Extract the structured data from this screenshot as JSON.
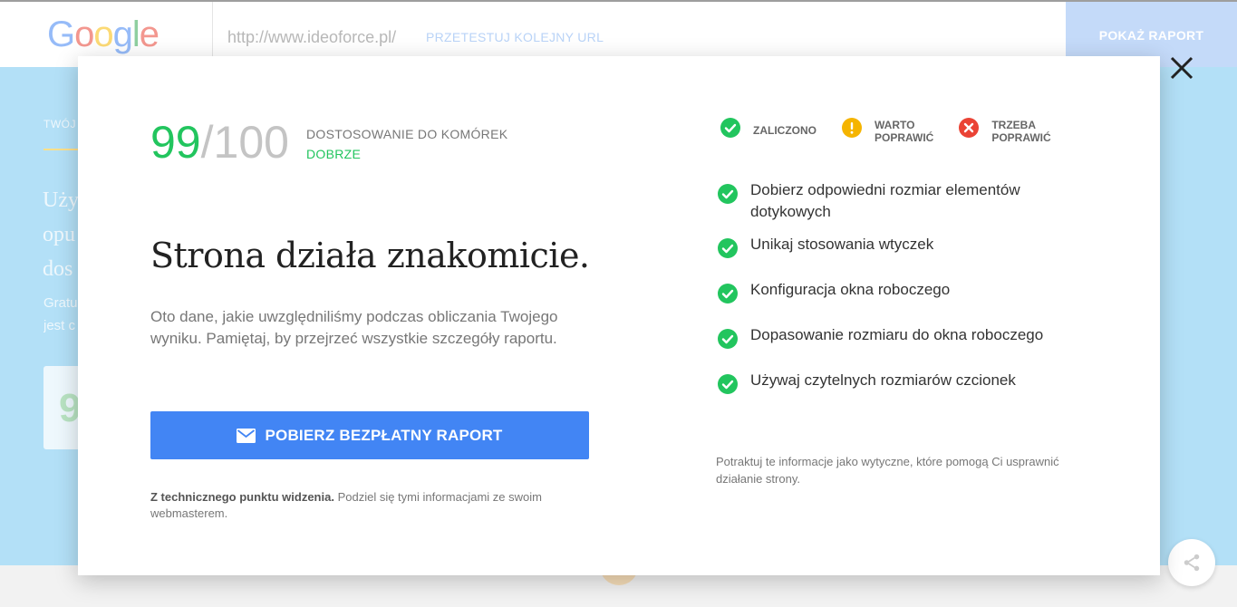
{
  "background": {
    "logo": {
      "g1": "G",
      "o1": "o",
      "o2": "o",
      "g2": "g",
      "l": "l",
      "e": "e"
    },
    "url": "http://www.ideoforce.pl/",
    "retest_label": "PRZETESTUJ KOLEJNY URL",
    "show_report_label": "POKAŻ RAPORT",
    "hero_label": "TWÓJ",
    "hero_text": [
      "Uży",
      "opu",
      "dos"
    ],
    "hero_small": [
      "Gratu",
      "jest c"
    ],
    "hero_card_value": "9"
  },
  "modal": {
    "close_icon": "close-icon",
    "score": {
      "value": "99",
      "max": "/100"
    },
    "score_title": "DOSTOSOWANIE DO KOMÓREK",
    "score_status": "DOBRZE",
    "headline": "Strona działa znakomicie.",
    "intro": "Oto dane, jakie uwzględniliśmy podczas obliczania Twojego wyniku. Pamiętaj, by przejrzeć wszystkie szczegóły raportu.",
    "download_button": "POBIERZ BEZPŁATNY RAPORT",
    "tech_note_bold": "Z technicznego punktu widzenia.",
    "tech_note_rest": " Podziel się tymi informacjami ze swoim webmasterem.",
    "legend": {
      "passed_line1": "ZALICZONO",
      "warn_line1": "WARTO",
      "warn_line2": "POPRAWIĆ",
      "fail_line1": "TRZEBA",
      "fail_line2": "POPRAWIĆ"
    },
    "checks": [
      {
        "label": "Dobierz odpowiedni rozmiar elementów dotykowych"
      },
      {
        "label": "Unikaj stosowania wtyczek"
      },
      {
        "label": "Konfiguracja okna roboczego"
      },
      {
        "label": "Dopasowanie rozmiaru do okna roboczego"
      },
      {
        "label": "Używaj czytelnych rozmiarów czcionek"
      }
    ],
    "guideline": "Potraktuj te informacje jako wytyczne, które pomogą Ci usprawnić działanie strony."
  },
  "colors": {
    "pass": "#22c55e",
    "warn": "#f5b400",
    "fail": "#ea4335",
    "primary": "#4285f4"
  }
}
